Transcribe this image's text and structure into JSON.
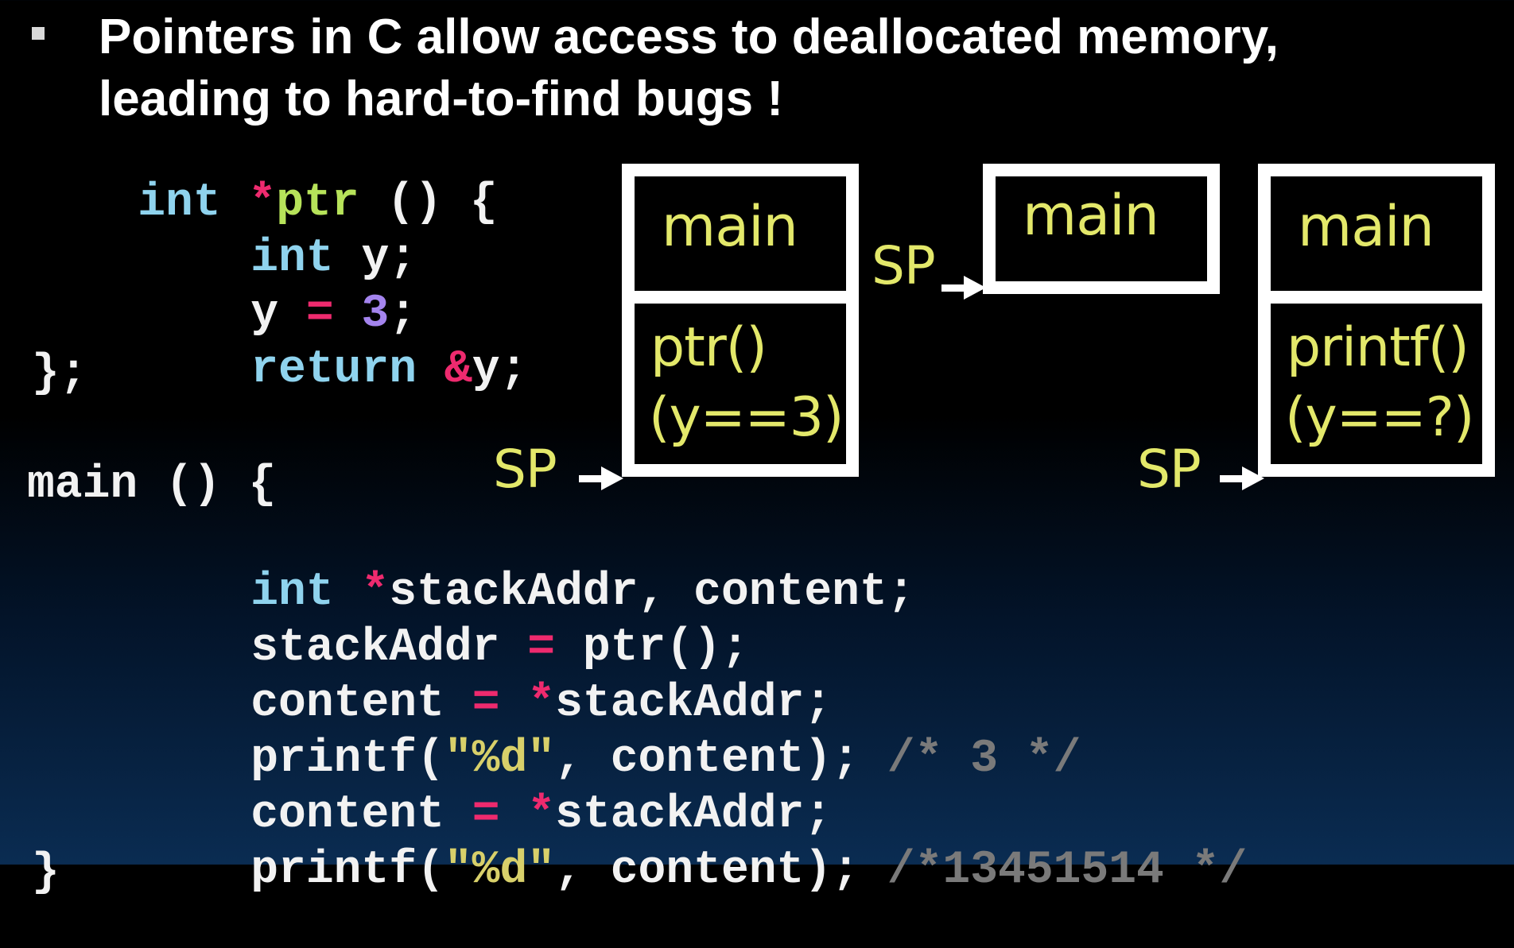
{
  "bullet": {
    "line1": "Pointers in C allow access to deallocated memory,",
    "line2": "leading to hard-to-find bugs !"
  },
  "code": {
    "l1": [
      "int",
      " ",
      "*",
      "ptr",
      " () {"
    ],
    "l2": [
      "int",
      " y;"
    ],
    "l3": [
      "y ",
      "=",
      " ",
      "3",
      ";"
    ],
    "l4": [
      "return",
      " ",
      "&",
      "y;"
    ],
    "l5": "};",
    "l6": "main () {",
    "l7": [
      "int",
      " ",
      "*",
      "stackAddr, content;"
    ],
    "l8": [
      "stackAddr ",
      "=",
      " ptr();"
    ],
    "l9": [
      "content ",
      "=",
      " ",
      "*",
      "stackAddr;"
    ],
    "l10": [
      "printf(",
      "\"%d\"",
      ", content); ",
      "/* 3 */"
    ],
    "l11": [
      "content ",
      "=",
      " ",
      "*",
      "stackAddr;"
    ],
    "l12": [
      "printf(",
      "\"%d\"",
      ", content); ",
      "/*13451514 */"
    ],
    "l13": "}"
  },
  "diagram": {
    "stack1": {
      "top": "main",
      "frame_line1": "ptr()",
      "frame_line2": "(y==3)",
      "sp": "SP"
    },
    "stack2": {
      "top": "main",
      "sp": "SP"
    },
    "stack3": {
      "top": "main",
      "frame_line1": "printf()",
      "frame_line2": "(y==?)",
      "sp": "SP"
    }
  },
  "colors": {
    "keyword": "#8fd3ee",
    "operator": "#ee2a6e",
    "function_name": "#b7e35a",
    "number": "#a484ee",
    "string": "#d8d06a",
    "comment": "#7a7a7a",
    "diagram_label": "#e3e86a"
  }
}
